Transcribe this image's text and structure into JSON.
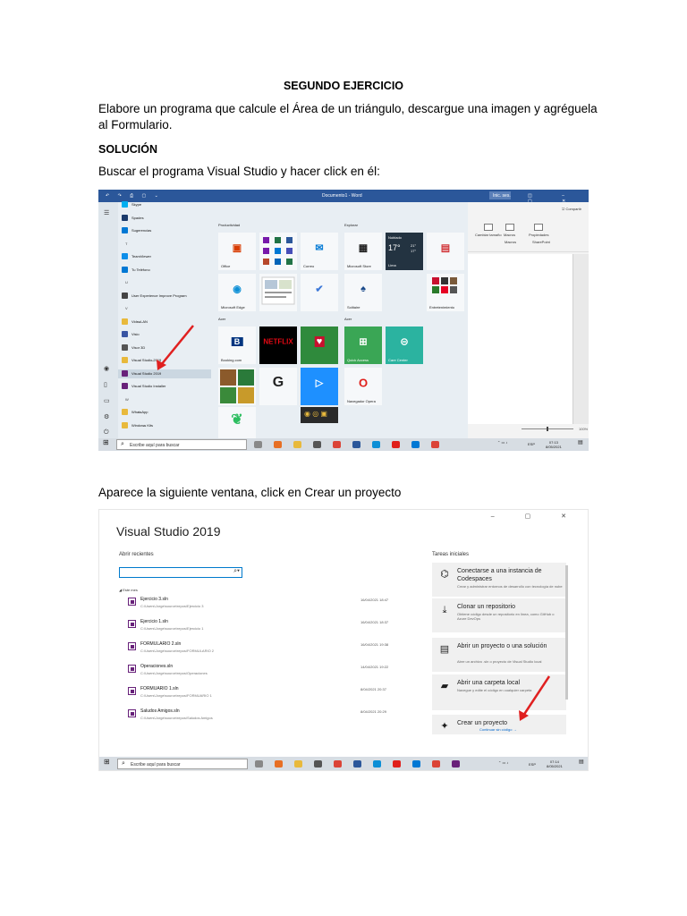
{
  "doc": {
    "title": "SEGUNDO EJERCICIO",
    "p1": "Elabore un programa que calcule el Área de un triángulo, descargue una imagen y agréguela al Formulario.",
    "solucion": "SOLUCIÓN",
    "p2": "Buscar el programa Visual Studio y hacer click en él:",
    "p3": "Aparece la siguiente ventana, click en Crear un proyecto"
  },
  "shot1": {
    "word_title": "Documento1 - Word",
    "start_button": "Inic. ses.",
    "share": "Compartir",
    "ribbon_groups": [
      {
        "label": "Cambiar tamaño"
      },
      {
        "label": "Macros"
      },
      {
        "label": "Propiedades"
      }
    ],
    "ribbon_group_names": [
      "Macros",
      "SharePoint"
    ],
    "zoom": "100%",
    "app_list": [
      {
        "label": "Skype",
        "color": "#00aff0"
      },
      {
        "label": "Spades",
        "color": "#1b3a6b"
      },
      {
        "label": "Sugerencias",
        "color": "#0078d4"
      },
      {
        "letter": "T"
      },
      {
        "label": "TeamViewer",
        "color": "#0e8ee9"
      },
      {
        "label": "Tu Teléfono",
        "color": "#0078d4"
      },
      {
        "letter": "U"
      },
      {
        "label": "User Experience Improve Program",
        "color": "#444444"
      },
      {
        "letter": "V"
      },
      {
        "label": "VideoLAN",
        "color": "#e8b93c",
        "folder": true
      },
      {
        "label": "Visio",
        "color": "#3955a3"
      },
      {
        "label": "Visor 3D",
        "color": "#555555"
      },
      {
        "label": "Visual Studio 2019",
        "color": "#e8b93c",
        "folder": true
      },
      {
        "label": "Visual Studio 2019",
        "color": "#68217a",
        "highlight": true
      },
      {
        "label": "Visual Studio Installer",
        "color": "#68217a"
      },
      {
        "letter": "W"
      },
      {
        "label": "WhatsApp",
        "color": "#e8b93c",
        "folder": true
      },
      {
        "label": "Windows Kits",
        "color": "#e8b93c",
        "folder": true
      }
    ],
    "sections": {
      "productividad": "Productividad",
      "explorar": "Explorar",
      "acer1": "Acer",
      "acer2": "Acer"
    },
    "tiles": {
      "office": "Office",
      "correo": "Correo",
      "edge": "Microsoft Edge",
      "store": "Microsoft Store",
      "solitaire": "Solitaire",
      "entretenimiento": "Entretenimiento",
      "booking": "Booking.com",
      "netflix": "NETFLIX",
      "quickaccess": "Quick Access",
      "carecenter": "Care Center",
      "opera": "Navegador Opera",
      "weather_label": "Nublado",
      "weather_temp": "17°",
      "weather_hi": "21°",
      "weather_lo": "17°",
      "weather_city": "Lima"
    },
    "taskbar": {
      "search": "Escribe aquí para buscar",
      "lang": "ESP",
      "time": "07:13",
      "date": "8/05/2021"
    }
  },
  "shot2": {
    "title": "Visual Studio 2019",
    "abrir_recientes": "Abrir recientes",
    "tareas_iniciales": "Tareas iniciales",
    "group": "Este mes",
    "recent": [
      {
        "name": "Ejercicio 3.sln",
        "path": "C:\\Users\\Jorge\\source\\repos\\Ejercicio 3",
        "date": "16/04/2021 18:47"
      },
      {
        "name": "Ejercicio 1.sln",
        "path": "C:\\Users\\Jorge\\source\\repos\\Ejercicio 1",
        "date": "16/04/2021 18:37"
      },
      {
        "name": "FORMULARIO 2.sln",
        "path": "C:\\Users\\Jorge\\source\\repos\\FORMULARIO 2",
        "date": "16/04/2021 19:38"
      },
      {
        "name": "Operaciones.sln",
        "path": "C:\\Users\\Jorge\\source\\repos\\Operaciones",
        "date": "14/04/2021 19:22"
      },
      {
        "name": "FORMUARIO 1.sln",
        "path": "C:\\Users\\Jorge\\source\\repos\\FORMUARIO 1",
        "date": "8/04/2021 20:37"
      },
      {
        "name": "Saludos Amigos.sln",
        "path": "C:\\Users\\Jorge\\source\\repos\\Saludos Amigos",
        "date": "8/04/2021 20:29"
      }
    ],
    "tasks": [
      {
        "title": "Conectarse a una instancia de Codespaces",
        "desc": "Crear y administrar entornos de desarrollo con tecnología de nube",
        "icon": "⌬"
      },
      {
        "title": "Clonar un repositorio",
        "desc": "Obtiene código desde un repositorio en línea, como GitHub o Azure DevOps",
        "icon": "⤓"
      },
      {
        "title": "Abrir un proyecto o una solución",
        "desc": "Abre un archivo .sln o proyecto de Visual Studio local",
        "icon": "▤"
      },
      {
        "title": "Abrir una carpeta local",
        "desc": "Navegue y edite el código en cualquier carpeta",
        "icon": "▰"
      },
      {
        "title": "Crear un proyecto",
        "desc": "",
        "icon": "✦"
      }
    ],
    "continue": "Continuar sin código →",
    "taskbar": {
      "search": "Escribe aquí para buscar",
      "lang": "ESP",
      "time": "07:14",
      "date": "8/05/2021"
    }
  },
  "colors": {
    "word_blue": "#2b579a",
    "vs_purple": "#68217a",
    "arrow_red": "#e02020",
    "netflix_red": "#e50914",
    "acer_green": "#3aa655"
  }
}
